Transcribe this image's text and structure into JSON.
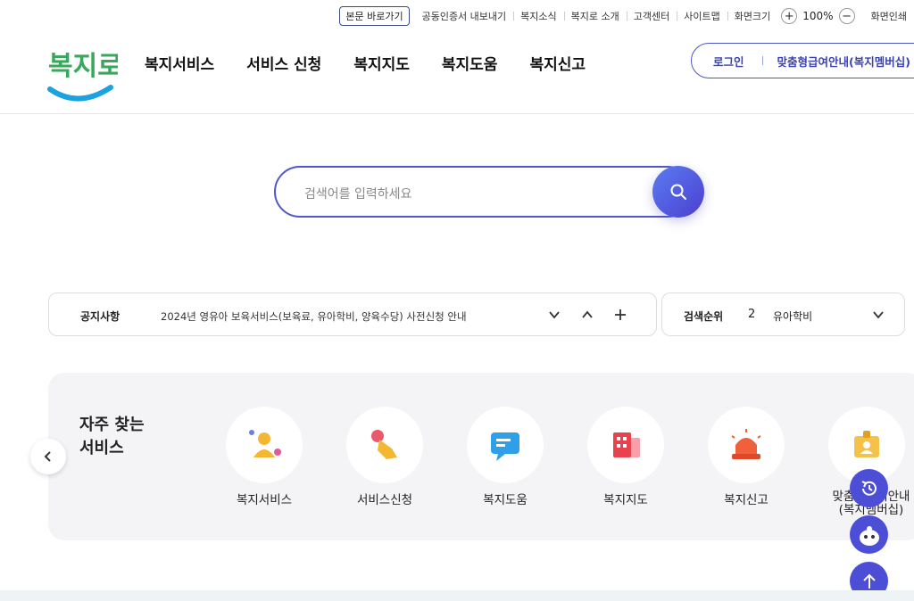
{
  "utility": {
    "skip_link": "본문 바로가기",
    "links": [
      "공동인증서 내보내기",
      "복지소식",
      "복지로 소개",
      "고객센터",
      "사이트맵"
    ],
    "zoom_label": "화면크기",
    "zoom_value": "100%",
    "print_label": "화면인쇄"
  },
  "header": {
    "logo_text": "복지로",
    "nav": [
      "복지서비스",
      "서비스 신청",
      "복지지도",
      "복지도움",
      "복지신고"
    ],
    "login": "로그인",
    "membership": "맞춤형급여안내(복지멤버십)"
  },
  "search": {
    "placeholder": "검색어를 입력하세요"
  },
  "notice": {
    "title": "공지사항",
    "text": "2024년 영유아 보육서비스(보육료, 유아학비, 양육수당) 사전신청 안내"
  },
  "ranking": {
    "title": "검색순위",
    "number": "2",
    "keyword": "유아학비"
  },
  "favorites": {
    "title_line1": "자주 찾는",
    "title_line2": "서비스",
    "items": [
      {
        "label": "복지서비스",
        "icon": "person-icon"
      },
      {
        "label": "서비스신청",
        "icon": "hand-tap-icon"
      },
      {
        "label": "복지도움",
        "icon": "chat-icon"
      },
      {
        "label": "복지지도",
        "icon": "building-icon"
      },
      {
        "label": "복지신고",
        "icon": "siren-icon"
      },
      {
        "label_line1": "맞춤형급여안내",
        "label_line2": "(복지멤버십)",
        "icon": "id-card-icon"
      }
    ]
  },
  "colors": {
    "accent": "#4b54c8",
    "logo_green": "#3aa85b",
    "logo_blue": "#1aa3e0"
  }
}
